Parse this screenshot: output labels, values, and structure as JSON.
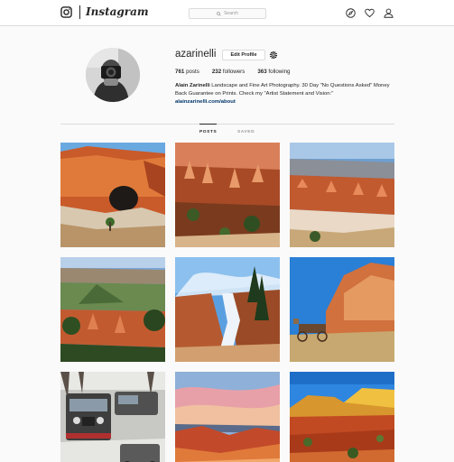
{
  "header": {
    "brand": "Instagram",
    "search_placeholder": "Search",
    "icons": [
      "instagram-logo-icon",
      "search-icon",
      "compass-icon",
      "heart-icon",
      "person-icon"
    ]
  },
  "profile": {
    "username": "azarinelli",
    "edit_label": "Edit Profile",
    "stats": {
      "posts_count": "761",
      "posts_label": "posts",
      "followers_count": "232",
      "followers_label": "followers",
      "following_count": "363",
      "following_label": "following"
    },
    "bio_name": "Alain Zarinelli",
    "bio_text": " Landscape and Fine Art Photography. 30 Day \"No Questions Asked\" Money Back Guarantee on Prints. Check my \"Artist Statement and Vision:\"",
    "link": "alainzarinelli.com/about"
  },
  "tabs": {
    "posts": "POSTS",
    "saved": "SAVED"
  },
  "grid": {
    "posts": [
      {
        "subject": "red rock arch"
      },
      {
        "subject": "hoodoo canyon"
      },
      {
        "subject": "canyon vista"
      },
      {
        "subject": "canyon overlook with trees"
      },
      {
        "subject": "frozen waterfall"
      },
      {
        "subject": "wagon and red cliffs"
      },
      {
        "subject": "jeeps in snow"
      },
      {
        "subject": "sunset over red hills"
      },
      {
        "subject": "desert mesa"
      }
    ]
  },
  "colors": {
    "background": "#fafafa",
    "link": "#003569",
    "border": "#dbdbdb"
  }
}
